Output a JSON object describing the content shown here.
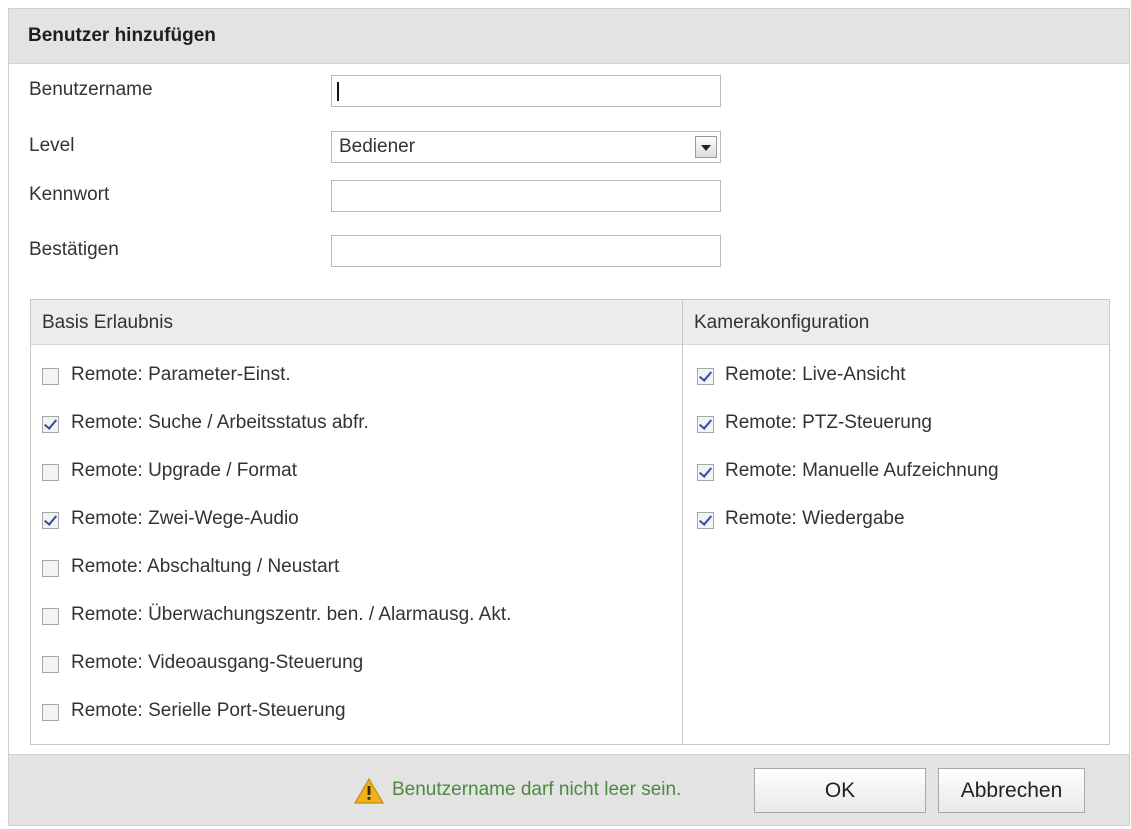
{
  "dialog": {
    "title": "Benutzer hinzufügen"
  },
  "form": {
    "username": {
      "label": "Benutzername",
      "value": ""
    },
    "level": {
      "label": "Level",
      "value": "Bediener"
    },
    "password": {
      "label": "Kennwort",
      "value": ""
    },
    "confirm": {
      "label": "Bestätigen",
      "value": ""
    }
  },
  "basic_permissions": {
    "header": "Basis Erlaubnis",
    "items": [
      {
        "label": "Remote: Parameter-Einst.",
        "checked": false
      },
      {
        "label": "Remote: Suche / Arbeitsstatus abfr.",
        "checked": true
      },
      {
        "label": "Remote: Upgrade / Format",
        "checked": false
      },
      {
        "label": "Remote: Zwei-Wege-Audio",
        "checked": true
      },
      {
        "label": "Remote: Abschaltung / Neustart",
        "checked": false
      },
      {
        "label": "Remote: Überwachungszentr. ben. / Alarmausg. Akt.",
        "checked": false
      },
      {
        "label": "Remote: Videoausgang-Steuerung",
        "checked": false
      },
      {
        "label": "Remote: Serielle Port-Steuerung",
        "checked": false
      }
    ]
  },
  "camera_config": {
    "header": "Kamerakonfiguration",
    "items": [
      {
        "label": "Remote: Live-Ansicht",
        "checked": true
      },
      {
        "label": "Remote: PTZ-Steuerung",
        "checked": true
      },
      {
        "label": "Remote: Manuelle Aufzeichnung",
        "checked": true
      },
      {
        "label": "Remote: Wiedergabe",
        "checked": true
      }
    ]
  },
  "footer": {
    "warning_icon": "warning-triangle-icon",
    "warning": "Benutzername darf nicht leer sein.",
    "ok_label": "OK",
    "cancel_label": "Abbrechen"
  },
  "colors": {
    "warning_text": "#4c8a40",
    "check_mark": "#2d4f9b",
    "warning_icon": "#f0b21c"
  }
}
